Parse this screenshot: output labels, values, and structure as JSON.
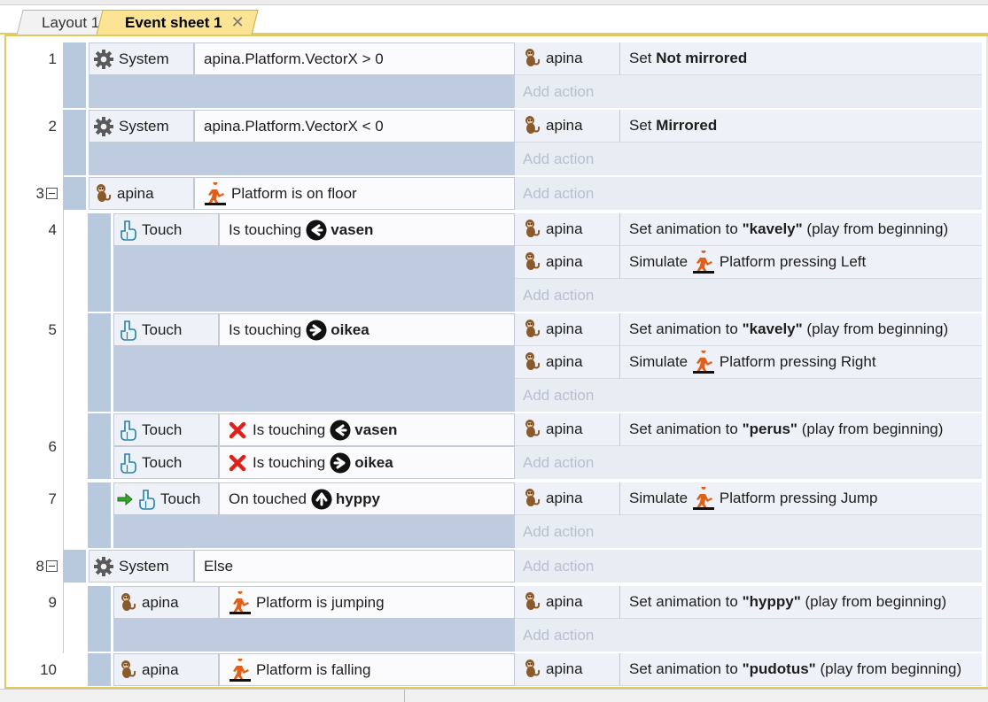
{
  "tabs": [
    {
      "label": "Layout 1",
      "active": false
    },
    {
      "label": "Event sheet 1",
      "active": true,
      "close": "✕"
    }
  ],
  "add_action_label": "Add action",
  "events": [
    {
      "number": "1",
      "conditions": [
        {
          "object": "System",
          "icon": "gear-icon",
          "text": "apina.Platform.VectorX > 0"
        }
      ],
      "actions": [
        {
          "object": "apina",
          "pre": "Set ",
          "bold": "Not mirrored",
          "post": ""
        }
      ]
    },
    {
      "number": "2",
      "conditions": [
        {
          "object": "System",
          "icon": "gear-icon",
          "text": "apina.Platform.VectorX < 0"
        }
      ],
      "actions": [
        {
          "object": "apina",
          "pre": "Set ",
          "bold": "Mirrored",
          "post": ""
        }
      ]
    },
    {
      "number": "3",
      "conditions": [
        {
          "object": "apina",
          "icon": "monkey-icon",
          "text": "Platform is on floor"
        }
      ],
      "actions": []
    },
    {
      "number": "4",
      "conditions": [
        {
          "object": "Touch",
          "icon": "touch-icon",
          "text": "Is touching",
          "target": "vasen",
          "arrow": "left"
        }
      ],
      "actions": [
        {
          "object": "apina",
          "pre": "Set animation to ",
          "bold": "\"kavely\"",
          "post": " (play from beginning)"
        },
        {
          "object": "apina",
          "pre": "Simulate ",
          "behavior": "Platform",
          "post": " pressing Left"
        }
      ]
    },
    {
      "number": "5",
      "conditions": [
        {
          "object": "Touch",
          "icon": "touch-icon",
          "text": "Is touching",
          "target": "oikea",
          "arrow": "right"
        }
      ],
      "actions": [
        {
          "object": "apina",
          "pre": "Set animation to ",
          "bold": "\"kavely\"",
          "post": " (play from beginning)"
        },
        {
          "object": "apina",
          "pre": "Simulate ",
          "behavior": "Platform",
          "post": " pressing Right"
        }
      ]
    },
    {
      "number": "6",
      "conditions": [
        {
          "object": "Touch",
          "icon": "touch-icon",
          "text": "Is touching",
          "target": "vasen",
          "arrow": "left",
          "inverted": true
        },
        {
          "object": "Touch",
          "icon": "touch-icon",
          "text": "Is touching",
          "target": "oikea",
          "arrow": "right",
          "inverted": true
        }
      ],
      "actions": [
        {
          "object": "apina",
          "pre": "Set animation to ",
          "bold": "\"perus\"",
          "post": " (play from beginning)"
        }
      ]
    },
    {
      "number": "7",
      "conditions": [
        {
          "object": "Touch",
          "icon": "touch-icon",
          "text": "On touched",
          "target": "hyppy",
          "arrow": "up",
          "trigger": true
        }
      ],
      "actions": [
        {
          "object": "apina",
          "pre": "Simulate ",
          "behavior": "Platform",
          "post": " pressing Jump"
        }
      ]
    },
    {
      "number": "8",
      "conditions": [
        {
          "object": "System",
          "icon": "gear-icon",
          "text": "Else"
        }
      ],
      "actions": []
    },
    {
      "number": "9",
      "conditions": [
        {
          "object": "apina",
          "icon": "monkey-icon",
          "text": "Platform is jumping"
        }
      ],
      "actions": [
        {
          "object": "apina",
          "pre": "Set animation to ",
          "bold": "\"hyppy\"",
          "post": " (play from beginning)"
        }
      ]
    },
    {
      "number": "10",
      "conditions": [
        {
          "object": "apina",
          "icon": "monkey-icon",
          "text": "Platform is falling"
        }
      ],
      "actions": [
        {
          "object": "apina",
          "pre": "Set animation to ",
          "bold": "\"pudotus\"",
          "post": " (play from beginning)"
        }
      ]
    }
  ]
}
